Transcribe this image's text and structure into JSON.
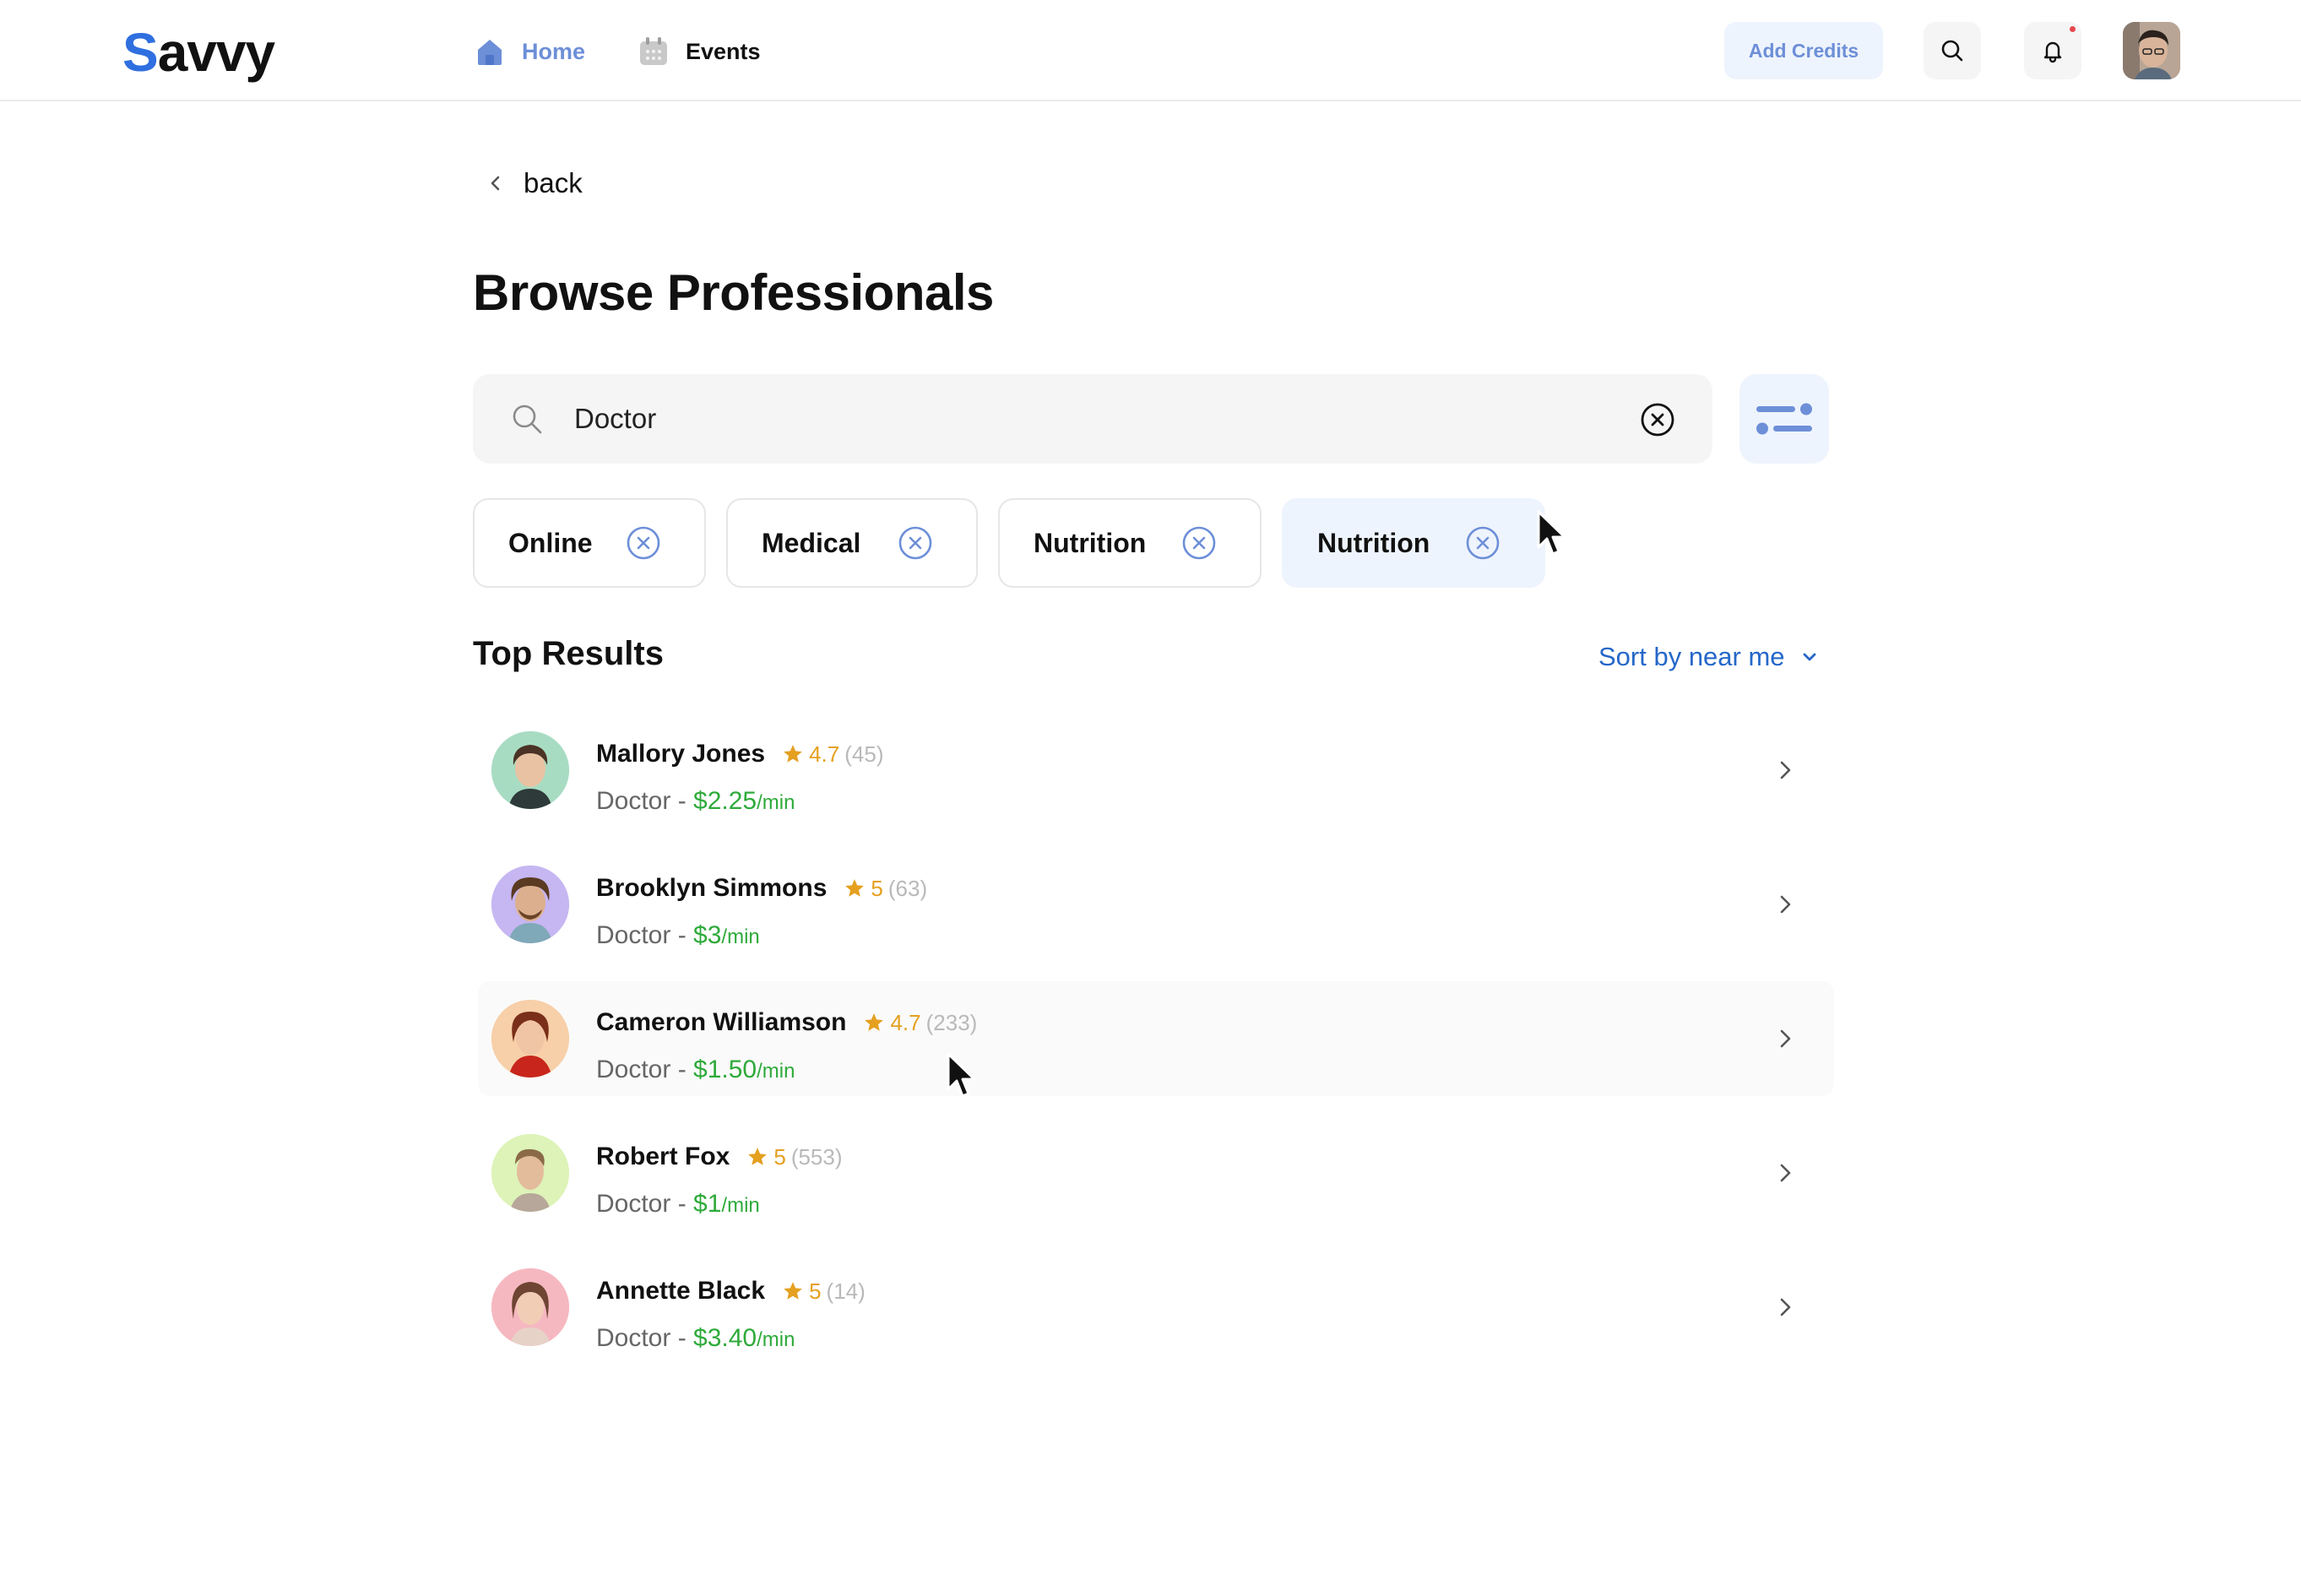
{
  "app": {
    "logo_text": "avvy",
    "logo_s": "S"
  },
  "nav": {
    "home_label": "Home",
    "events_label": "Events",
    "add_credits_label": "Add Credits",
    "accent_color": "#6d8fd8"
  },
  "page": {
    "back_label": "back",
    "title": "Browse Professionals"
  },
  "search": {
    "value": "Doctor",
    "placeholder": ""
  },
  "filters": [
    {
      "label": "Online",
      "active": false
    },
    {
      "label": "Medical",
      "active": false
    },
    {
      "label": "Nutrition",
      "active": false
    },
    {
      "label": "Nutrition",
      "active": true
    }
  ],
  "results": {
    "title": "Top Results",
    "sort_label": "Sort by near me",
    "items": [
      {
        "name": "Mallory Jones",
        "rating": "4.7",
        "count": "(45)",
        "role": "Doctor - ",
        "price": "$2.25",
        "unit": "/min",
        "avatar_bg": "#a8dcc2"
      },
      {
        "name": "Brooklyn Simmons",
        "rating": "5",
        "count": "(63)",
        "role": "Doctor - ",
        "price": "$3",
        "unit": "/min",
        "avatar_bg": "#c6b6f2"
      },
      {
        "name": "Cameron Williamson",
        "rating": "4.7",
        "count": "(233)",
        "role": "Doctor - ",
        "price": "$1.50",
        "unit": "/min",
        "avatar_bg": "#f7cfa8"
      },
      {
        "name": "Robert Fox",
        "rating": "5",
        "count": "(553)",
        "role": "Doctor - ",
        "price": "$1",
        "unit": "/min",
        "avatar_bg": "#ddf3b8"
      },
      {
        "name": "Annette Black",
        "rating": "5",
        "count": "(14)",
        "role": "Doctor - ",
        "price": "$3.40",
        "unit": "/min",
        "avatar_bg": "#f6b8c0"
      }
    ]
  }
}
